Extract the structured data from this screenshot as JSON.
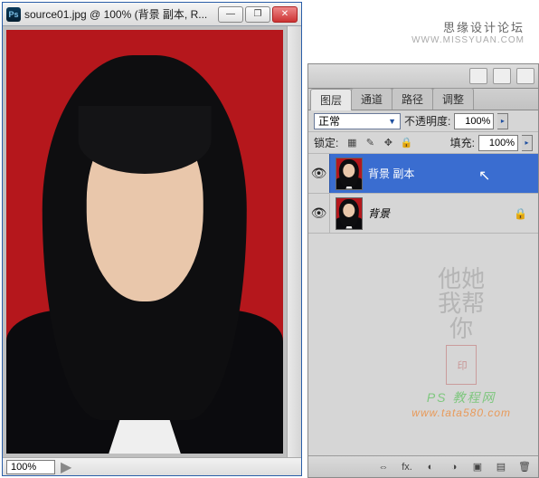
{
  "document": {
    "ps_badge": "Ps",
    "title": "source01.jpg @ 100% (背景 副本, R...",
    "zoom": "100%",
    "status_arrow": "▶"
  },
  "window_buttons": {
    "min": "—",
    "max": "❐",
    "close": "✕"
  },
  "brand": {
    "cn": "思缘设计论坛",
    "en": "WWW.MISSYUAN.COM"
  },
  "panels": {
    "tabs": [
      "图层",
      "通道",
      "路径",
      "调整"
    ],
    "active_tab_index": 0,
    "blend_mode": "正常",
    "opacity_label": "不透明度:",
    "opacity_value": "100%",
    "lock_label": "锁定:",
    "fill_label": "填充:",
    "fill_value": "100%"
  },
  "lock_icons": {
    "pixels": "▦",
    "brush": "✎",
    "move": "✥",
    "all": "🔒"
  },
  "layers": [
    {
      "name": "背景 副本",
      "visible": true,
      "selected": true,
      "locked": false
    },
    {
      "name": "背景",
      "visible": true,
      "selected": false,
      "locked": true
    }
  ],
  "icons": {
    "eye": "👁",
    "lock": "🔒",
    "cursor": "↖",
    "dropdown": "▼",
    "expand": "▸"
  },
  "footer_icons": {
    "link": "⇔",
    "fx": "fx.",
    "mask": "◐",
    "adjust": "◑",
    "folder": "▣",
    "new": "▤",
    "trash": "🗑"
  },
  "watermark": {
    "ink_lines": [
      "他她",
      "我帮",
      "你"
    ],
    "seal": "印",
    "line1": "PS 教程网",
    "line2": "www.tata580.com"
  }
}
